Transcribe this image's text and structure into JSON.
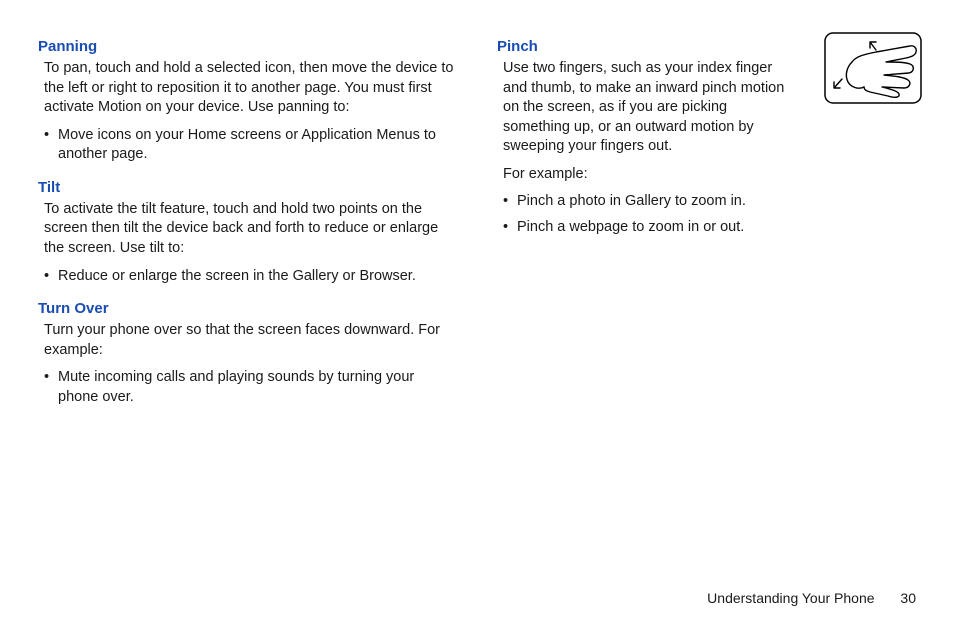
{
  "left": {
    "panning": {
      "heading": "Panning",
      "text": "To pan, touch and hold a selected icon, then move the device to the left or right to reposition it to another page. You must first activate Motion on your device. Use panning to:",
      "bullets": [
        "Move icons on your Home screens or Application Menus to another page."
      ]
    },
    "tilt": {
      "heading": "Tilt",
      "text": "To activate the tilt feature, touch and hold two points on the screen then tilt the device back and forth to reduce or enlarge the screen. Use tilt to:",
      "bullets": [
        "Reduce or enlarge the screen in the Gallery or Browser."
      ]
    },
    "turnover": {
      "heading": "Turn Over",
      "text": "Turn your phone over so that the screen faces downward. For example:",
      "bullets": [
        "Mute incoming calls and playing sounds by turning your phone over."
      ]
    }
  },
  "right": {
    "pinch": {
      "heading": "Pinch",
      "text": "Use two fingers, such as your index finger and thumb, to make an inward pinch motion on the screen, as if you are picking something up, or an outward motion by sweeping your fingers out.",
      "eg": "For example:",
      "bullets": [
        "Pinch a photo in Gallery to zoom in.",
        "Pinch a webpage to zoom in or out."
      ]
    }
  },
  "footer": {
    "section": "Understanding Your Phone",
    "page": "30"
  }
}
